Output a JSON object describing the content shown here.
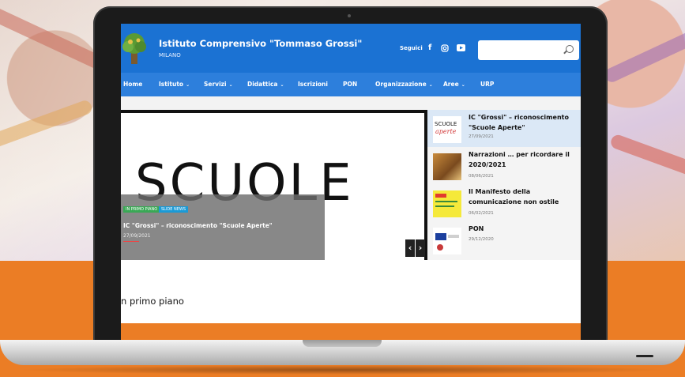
{
  "header": {
    "school_name": "Istituto Comprensivo \"Tommaso Grossi\"",
    "city": "MILANO",
    "follow_label": "Seguici",
    "social_icons": [
      "facebook-icon",
      "instagram-icon",
      "youtube-icon"
    ],
    "search_placeholder": ""
  },
  "nav": {
    "items": [
      {
        "label": "Home",
        "dropdown": false
      },
      {
        "label": "Istituto",
        "dropdown": true
      },
      {
        "label": "Servizi",
        "dropdown": true
      },
      {
        "label": "Didattica",
        "dropdown": true
      },
      {
        "label": "Iscrizioni",
        "dropdown": false
      },
      {
        "label": "PON",
        "dropdown": false
      },
      {
        "label": "Organizzazione",
        "dropdown": true
      },
      {
        "label": "Aree",
        "dropdown": true
      },
      {
        "label": "URP",
        "dropdown": false
      }
    ]
  },
  "slider": {
    "image_word": "SCUOLE",
    "tags": [
      "IN PRIMO PIANO",
      "SLIDE NEWS"
    ],
    "caption_title": "IC \"Grossi\" – riconoscimento \"Scuole Aperte\"",
    "caption_date": "27/09/2021"
  },
  "news": [
    {
      "title": "IC \"Grossi\" – riconoscimento \"Scuole Aperte\"",
      "date": "27/09/2021",
      "thumb_text": "SCUOLE",
      "thumb_sub": "aperte"
    },
    {
      "title": "Narrazioni … per ricordare il 2020/2021",
      "date": "08/06/2021",
      "thumb_text": "",
      "thumb_sub": ""
    },
    {
      "title": "Il Manifesto della comunicazione non ostile",
      "date": "06/02/2021",
      "thumb_text": "",
      "thumb_sub": ""
    },
    {
      "title": "PON",
      "date": "29/12/2020",
      "thumb_text": "",
      "thumb_sub": ""
    }
  ],
  "section": {
    "title": "n primo piano"
  },
  "colors": {
    "header_blue": "#1b72d3",
    "nav_blue": "#2d7fdc",
    "accent_orange": "#eb7d25",
    "active_news_bg": "#dbe8f6"
  }
}
